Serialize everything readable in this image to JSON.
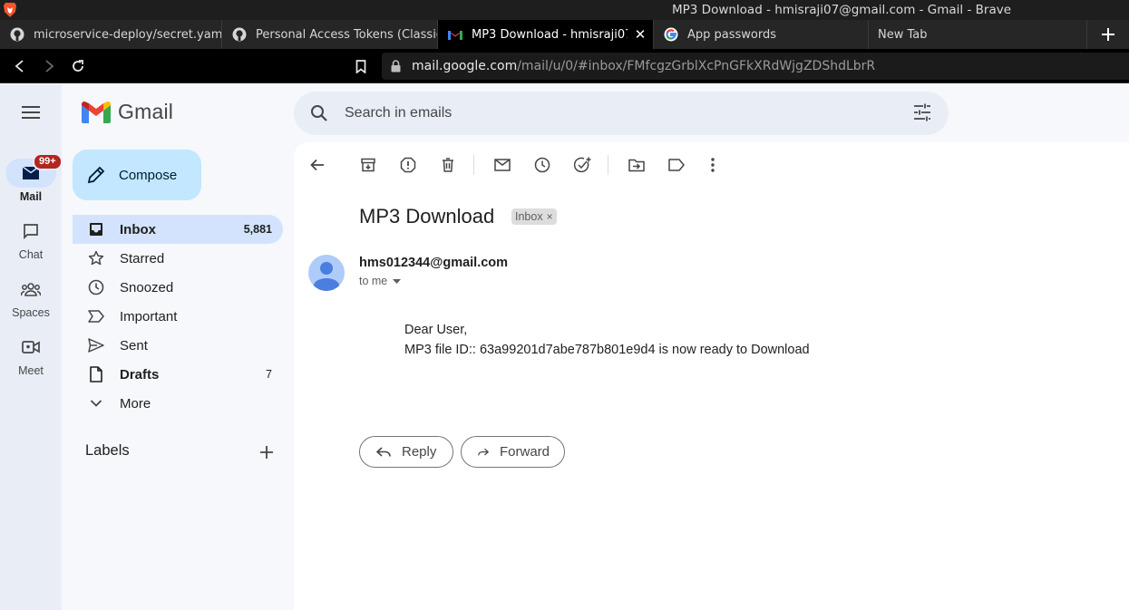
{
  "window": {
    "title": "MP3 Download - hmisraji07@gmail.com - Gmail - Brave"
  },
  "tabs": [
    {
      "label": "microservice-deploy/secret.yaml",
      "icon": "github-icon"
    },
    {
      "label": "Personal Access Tokens (Classic)",
      "icon": "github-icon"
    },
    {
      "label": "MP3 Download - hmisraji07@gmail.com",
      "icon": "gmail-icon",
      "active": true
    },
    {
      "label": "App passwords",
      "icon": "google-icon"
    },
    {
      "label": "New Tab",
      "icon": ""
    }
  ],
  "address": {
    "host": "mail.google.com",
    "path": "/mail/u/0/#inbox/FMfcgzGrblXcPnGFkXRdWjgZDShdLbrR"
  },
  "rail": {
    "mail_label": "Mail",
    "mail_badge": "99+",
    "chat_label": "Chat",
    "spaces_label": "Spaces",
    "meet_label": "Meet"
  },
  "brand": {
    "wordmark": "Gmail"
  },
  "compose": {
    "label": "Compose"
  },
  "nav": {
    "inbox": {
      "label": "Inbox",
      "count": "5,881"
    },
    "starred": {
      "label": "Starred"
    },
    "snoozed": {
      "label": "Snoozed"
    },
    "important": {
      "label": "Important"
    },
    "sent": {
      "label": "Sent"
    },
    "drafts": {
      "label": "Drafts",
      "count": "7"
    },
    "more": {
      "label": "More"
    }
  },
  "labels": {
    "heading": "Labels"
  },
  "search": {
    "placeholder": "Search in emails"
  },
  "email": {
    "subject": "MP3 Download",
    "folder_chip": "Inbox",
    "chip_close": "×",
    "sender": "hms012344@gmail.com",
    "recipient": "to me",
    "greeting": "Dear User,",
    "message": "MP3 file ID:: 63a99201d7abe787b801e9d4 is now ready to Download"
  },
  "actions": {
    "reply": "Reply",
    "forward": "Forward"
  },
  "colors": {
    "accent": "#c2e7ff",
    "selected": "#d3e3fd",
    "badge": "#b3261e"
  }
}
